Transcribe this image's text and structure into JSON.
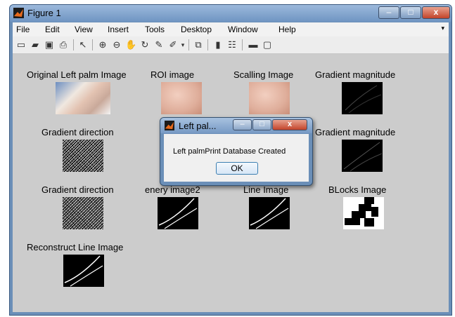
{
  "window": {
    "title": "Figure 1",
    "controls": {
      "minimize": "–",
      "maximize": "□",
      "close": "x"
    }
  },
  "menu": {
    "items": [
      "File",
      "Edit",
      "View",
      "Insert",
      "Tools",
      "Desktop",
      "Window",
      "Help"
    ],
    "overflow_arrow": "▾"
  },
  "toolbar": {
    "icons": [
      "new-figure-icon",
      "open-icon",
      "save-icon",
      "print-icon",
      "pointer-icon",
      "zoom-in-icon",
      "zoom-out-icon",
      "pan-icon",
      "rotate-icon",
      "data-cursor-icon",
      "brush-icon",
      "link-icon",
      "colorbar-icon",
      "legend-icon",
      "hide-plot-tools-icon",
      "show-plot-tools-icon"
    ]
  },
  "figure": {
    "labels": {
      "original": "Original Left palm Image",
      "roi": "ROI image",
      "scalling": "Scalling Image",
      "grad_mag_1": "Gradient magnitude",
      "grad_dir_1": "Gradient direction",
      "partial_ge": "ge",
      "grad_mag_2": "Gradient magnitude",
      "grad_dir_2": "Gradient direction",
      "enery": "enery image2",
      "line": "Line Image",
      "blocks": "BLocks Image",
      "reconstruct": "Reconstruct Line Image"
    }
  },
  "dialog": {
    "title": "Left pal...",
    "message": "Left palmPrint Database Created",
    "ok_label": "OK",
    "controls": {
      "minimize": "–",
      "maximize": "□",
      "close": "x"
    }
  }
}
